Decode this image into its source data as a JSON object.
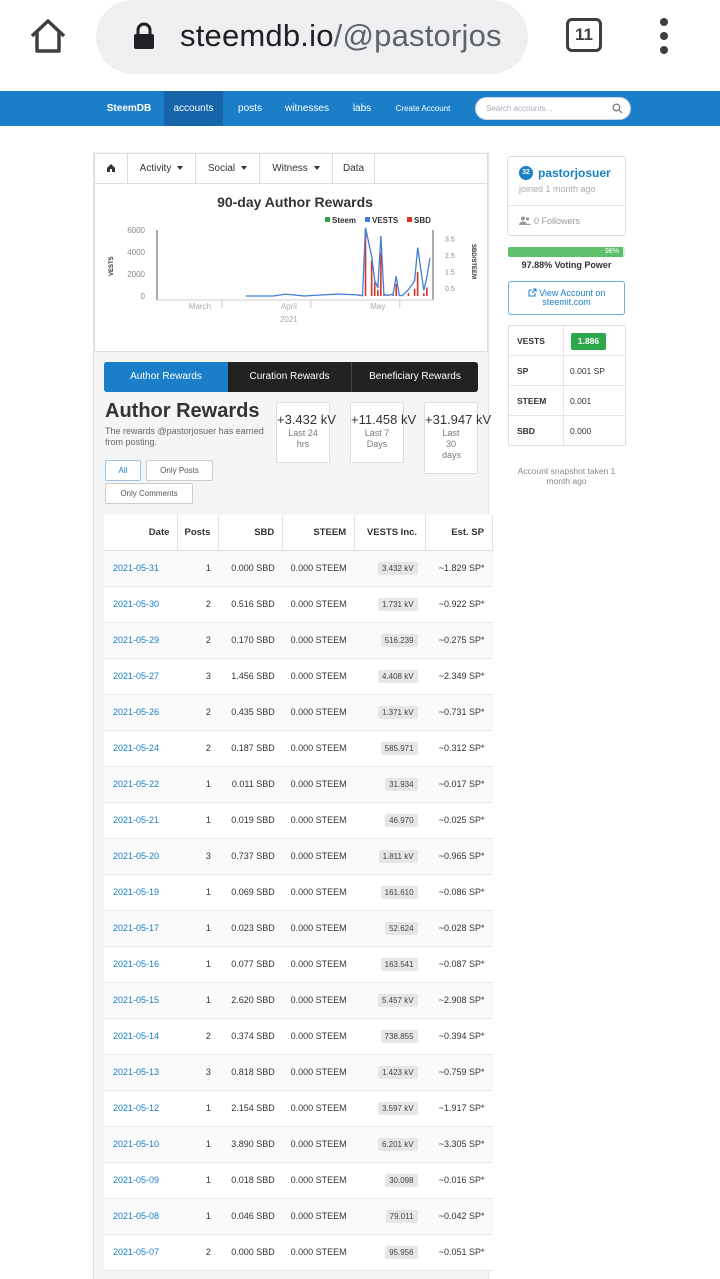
{
  "browser": {
    "url_main": "steemdb.io",
    "url_path": "/@pastorjos",
    "tab_count": "11"
  },
  "nav": {
    "brand": "SteemDB",
    "items": [
      "accounts",
      "posts",
      "witnesses",
      "labs",
      "Create Account"
    ],
    "search_placeholder": "Search accounts..."
  },
  "subnav": [
    "Activity",
    "Social",
    "Witness",
    "Data"
  ],
  "chart_data": {
    "type": "line",
    "title": "90-day Author Rewards",
    "legend": [
      "Steem",
      "VESTS",
      "SBD"
    ],
    "legend_colors": [
      "#2ea84c",
      "#3f7fd6",
      "#d9342b"
    ],
    "ylabel_left": "VESTS",
    "ylabel_right": "SBD/STEEM",
    "left_ticks": [
      "6000",
      "4000",
      "2000",
      "0"
    ],
    "right_ticks": [
      "3.5",
      "2.5",
      "1.5",
      "0.5"
    ],
    "x_ticks": [
      "March",
      "April",
      "May"
    ],
    "x_year": "2021",
    "ylim_left": [
      0,
      6000
    ],
    "ylim_right": [
      0,
      4
    ],
    "series": [
      {
        "name": "VESTS",
        "x": [
          "2021-04-01",
          "2021-04-10",
          "2021-04-14",
          "2021-04-20",
          "2021-05-01",
          "2021-05-07",
          "2021-05-08",
          "2021-05-09",
          "2021-05-10",
          "2021-05-12",
          "2021-05-13",
          "2021-05-14",
          "2021-05-15",
          "2021-05-16",
          "2021-05-17",
          "2021-05-19",
          "2021-05-20",
          "2021-05-21",
          "2021-05-22",
          "2021-05-24",
          "2021-05-26",
          "2021-05-27",
          "2021-05-29",
          "2021-05-30",
          "2021-05-31"
        ],
        "y": [
          0,
          0,
          170,
          0,
          180,
          96,
          79,
          30,
          6201,
          3597,
          1423,
          739,
          5457,
          164,
          53,
          162,
          1811,
          47,
          32,
          586,
          1371,
          4408,
          516,
          1731,
          3432
        ]
      },
      {
        "name": "SBD",
        "x": [
          "2021-05-07",
          "2021-05-08",
          "2021-05-09",
          "2021-05-10",
          "2021-05-12",
          "2021-05-13",
          "2021-05-14",
          "2021-05-15",
          "2021-05-16",
          "2021-05-17",
          "2021-05-19",
          "2021-05-20",
          "2021-05-21",
          "2021-05-22",
          "2021-05-24",
          "2021-05-26",
          "2021-05-27",
          "2021-05-29",
          "2021-05-30",
          "2021-05-31"
        ],
        "y": [
          0,
          0.046,
          0.018,
          3.89,
          2.154,
          0.818,
          0.374,
          2.62,
          0.077,
          0.023,
          0.069,
          0.737,
          0.019,
          0.011,
          0.187,
          0.435,
          1.456,
          0.17,
          0.516,
          0
        ]
      }
    ]
  },
  "reward_tabs": [
    "Author Rewards",
    "Curation Rewards",
    "Beneficiary Rewards"
  ],
  "section": {
    "title": "Author Rewards",
    "description": "The rewards @pastorjosuer has earned from posting."
  },
  "stats": [
    {
      "value": "+3.432 kV",
      "label": "Last 24 hrs"
    },
    {
      "value": "+11.458 kV",
      "label": "Last 7 Days"
    },
    {
      "value": "+31.947 kV",
      "label": "Last 30 days"
    }
  ],
  "filters": [
    "All",
    "Only Posts",
    "Only Comments"
  ],
  "table": {
    "headers": [
      "Date",
      "Posts",
      "SBD",
      "STEEM",
      "VESTS Inc.",
      "Est. SP"
    ],
    "rows": [
      [
        "2021-05-31",
        "1",
        "0.000 SBD",
        "0.000 STEEM",
        "3.432 kV",
        "~1.829 SP*"
      ],
      [
        "2021-05-30",
        "2",
        "0.516 SBD",
        "0.000 STEEM",
        "1.731 kV",
        "~0.922 SP*"
      ],
      [
        "2021-05-29",
        "2",
        "0.170 SBD",
        "0.000 STEEM",
        "516.239",
        "~0.275 SP*"
      ],
      [
        "2021-05-27",
        "3",
        "1.456 SBD",
        "0.000 STEEM",
        "4.408 kV",
        "~2.349 SP*"
      ],
      [
        "2021-05-26",
        "2",
        "0.435 SBD",
        "0.000 STEEM",
        "1.371 kV",
        "~0.731 SP*"
      ],
      [
        "2021-05-24",
        "2",
        "0.187 SBD",
        "0.000 STEEM",
        "585.971",
        "~0.312 SP*"
      ],
      [
        "2021-05-22",
        "1",
        "0.011 SBD",
        "0.000 STEEM",
        "31.934",
        "~0.017 SP*"
      ],
      [
        "2021-05-21",
        "1",
        "0.019 SBD",
        "0.000 STEEM",
        "46.970",
        "~0.025 SP*"
      ],
      [
        "2021-05-20",
        "3",
        "0.737 SBD",
        "0.000 STEEM",
        "1.811 kV",
        "~0.965 SP*"
      ],
      [
        "2021-05-19",
        "1",
        "0.069 SBD",
        "0.000 STEEM",
        "161.610",
        "~0.086 SP*"
      ],
      [
        "2021-05-17",
        "1",
        "0.023 SBD",
        "0.000 STEEM",
        "52.624",
        "~0.028 SP*"
      ],
      [
        "2021-05-16",
        "1",
        "0.077 SBD",
        "0.000 STEEM",
        "163.541",
        "~0.087 SP*"
      ],
      [
        "2021-05-15",
        "1",
        "2.620 SBD",
        "0.000 STEEM",
        "5.457 kV",
        "~2.908 SP*"
      ],
      [
        "2021-05-14",
        "2",
        "0.374 SBD",
        "0.000 STEEM",
        "738.855",
        "~0.394 SP*"
      ],
      [
        "2021-05-13",
        "3",
        "0.818 SBD",
        "0.000 STEEM",
        "1.423 kV",
        "~0.759 SP*"
      ],
      [
        "2021-05-12",
        "1",
        "2.154 SBD",
        "0.000 STEEM",
        "3.597 kV",
        "~1.917 SP*"
      ],
      [
        "2021-05-10",
        "1",
        "3.890 SBD",
        "0.000 STEEM",
        "6.201 kV",
        "~3.305 SP*"
      ],
      [
        "2021-05-09",
        "1",
        "0.018 SBD",
        "0.000 STEEM",
        "30.098",
        "~0.016 SP*"
      ],
      [
        "2021-05-08",
        "1",
        "0.046 SBD",
        "0.000 STEEM",
        "79.011",
        "~0.042 SP*"
      ],
      [
        "2021-05-07",
        "2",
        "0.000 SBD",
        "0.000 STEEM",
        "95.956",
        "~0.051 SP*"
      ]
    ]
  },
  "profile": {
    "level": "32",
    "name": "pastorjosuer",
    "joined": "joined 1 month ago",
    "followers": "0 Followers"
  },
  "voting": {
    "fraction": 0.9788,
    "bar_label": "98%",
    "text": "97.88% Voting Power"
  },
  "view_account": {
    "line1": "View Account on",
    "line2": "steemit.com"
  },
  "balances": [
    {
      "key": "VESTS",
      "value": "1.886"
    },
    {
      "key": "SP",
      "value": "0.001 SP"
    },
    {
      "key": "STEEM",
      "value": "0.001"
    },
    {
      "key": "SBD",
      "value": "0.000"
    }
  ],
  "snapshot": "Account snapshot taken 1 month ago",
  "colors": {
    "nav": "#1a7fc8",
    "accent": "#1a7fc8",
    "success": "#2ea84c"
  }
}
